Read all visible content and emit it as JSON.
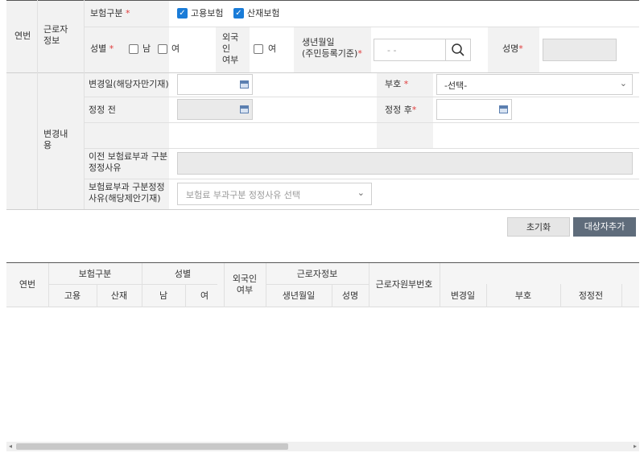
{
  "form": {
    "row_no": "연번",
    "worker_info": "근로자\n정보",
    "insurance_type": "보험구분",
    "employment_ins": "고용보험",
    "industrial_ins": "산재보험",
    "gender": "성별",
    "male": "남",
    "female": "여",
    "foreigner": "외국\n인\n여부",
    "foreigner_yes": "여",
    "birthdate": "생년월일\n(주민등록기준)",
    "birthdate_placeholder": "- -",
    "name": "성명",
    "change_content": "변경내\n용",
    "change_date": "변경일(해당자만기재)",
    "sign": "부호",
    "sign_select": "-선택-",
    "before_fix": "정정 전",
    "after_fix": "정정 후",
    "prev_reason": "이전 보험료부과 구분\n정정사유",
    "reason_label": "보험료부과 구분정정\n사유(해당제안기재)",
    "reason_select": "보험료 부과구분 정정사유 선택"
  },
  "buttons": {
    "reset": "초기화",
    "add_target": "대상자추가"
  },
  "grid": {
    "row_no": "연번",
    "insurance_type": "보험구분",
    "employment": "고용",
    "industrial": "산재",
    "gender": "성별",
    "male": "남",
    "female": "여",
    "foreigner": "외국인\n여부",
    "worker_info": "근로자정보",
    "birthdate": "생년월일",
    "name": "성명",
    "worker_no": "근로자원부번호",
    "change_date": "변경일",
    "sign": "부호",
    "before_fix": "정정전"
  },
  "colors": {
    "accent": "#1a7cd8",
    "primary_button": "#5f6c7b",
    "required": "#e03c3c"
  }
}
